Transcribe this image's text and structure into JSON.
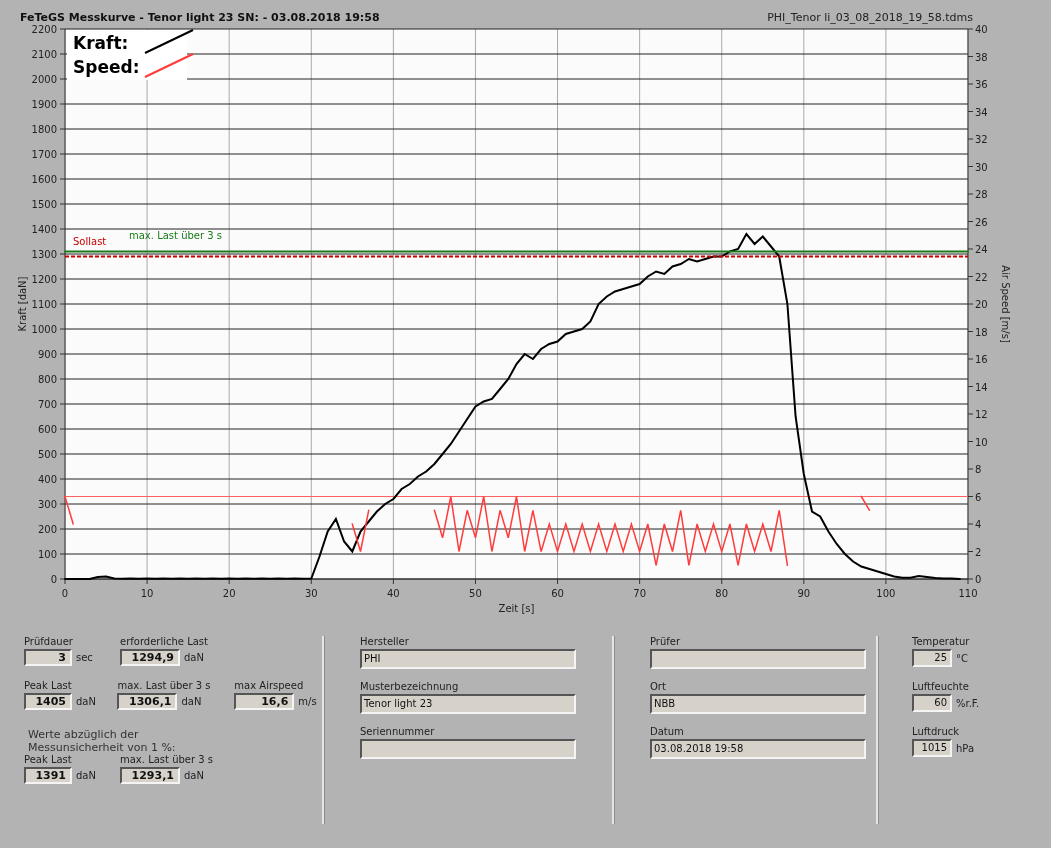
{
  "header": {
    "title": "FeTeGS Messkurve - Tenor light 23  SN:  - 03.08.2018 19:58",
    "file": "PHI_Tenor li_03_08_2018_19_58.tdms"
  },
  "chart": {
    "chart_data": {
      "type": "line",
      "xlabel": "Zeit [s]",
      "ylabel": "Kraft [daN]",
      "y2label": "Air Speed [m/s]",
      "xlim": [
        0,
        110
      ],
      "ylim": [
        0,
        2200
      ],
      "y2lim": [
        0,
        40
      ],
      "xticks": [
        0,
        10,
        20,
        30,
        40,
        50,
        60,
        70,
        80,
        90,
        100,
        110
      ],
      "yticks": [
        0,
        100,
        200,
        300,
        400,
        500,
        600,
        700,
        800,
        900,
        1000,
        1100,
        1200,
        1300,
        1400,
        1500,
        1600,
        1700,
        1800,
        1900,
        2000,
        2100,
        2200
      ],
      "y2ticks": [
        0,
        2,
        4,
        6,
        8,
        10,
        12,
        14,
        16,
        18,
        20,
        22,
        24,
        26,
        28,
        30,
        32,
        34,
        36,
        38,
        40
      ],
      "x": [
        0,
        1,
        2,
        3,
        4,
        5,
        6,
        7,
        8,
        9,
        10,
        11,
        12,
        13,
        14,
        15,
        16,
        17,
        18,
        19,
        20,
        21,
        22,
        23,
        24,
        25,
        26,
        27,
        28,
        29,
        30,
        31,
        32,
        33,
        34,
        35,
        36,
        37,
        38,
        39,
        40,
        41,
        42,
        43,
        44,
        45,
        46,
        47,
        48,
        49,
        50,
        51,
        52,
        53,
        54,
        55,
        56,
        57,
        58,
        59,
        60,
        61,
        62,
        63,
        64,
        65,
        66,
        67,
        68,
        69,
        70,
        71,
        72,
        73,
        74,
        75,
        76,
        77,
        78,
        79,
        80,
        81,
        82,
        83,
        84,
        85,
        86,
        87,
        88,
        89,
        90,
        91,
        92,
        93,
        94,
        95,
        96,
        97,
        98,
        99,
        100,
        101,
        102,
        103,
        104,
        105,
        106,
        107,
        108,
        109,
        110
      ],
      "series": [
        {
          "name": "Kraft:",
          "color": "#000000",
          "values": [
            0,
            0,
            0,
            0,
            8,
            10,
            2,
            1,
            2,
            1,
            2,
            1,
            2,
            1,
            2,
            1,
            2,
            1,
            2,
            1,
            2,
            1,
            2,
            1,
            2,
            1,
            2,
            1,
            2,
            1,
            2,
            90,
            190,
            240,
            150,
            110,
            190,
            230,
            270,
            300,
            320,
            360,
            380,
            410,
            430,
            460,
            500,
            540,
            590,
            640,
            690,
            710,
            720,
            760,
            800,
            860,
            900,
            880,
            920,
            940,
            950,
            980,
            990,
            1000,
            1030,
            1100,
            1130,
            1150,
            1160,
            1170,
            1180,
            1210,
            1230,
            1220,
            1250,
            1260,
            1280,
            1270,
            1280,
            1290,
            1290,
            1310,
            1320,
            1380,
            1340,
            1370,
            1330,
            1290,
            1100,
            650,
            420,
            270,
            250,
            190,
            140,
            100,
            70,
            50,
            40,
            30,
            20,
            10,
            5,
            5,
            12,
            8,
            4,
            2,
            2,
            0,
            null
          ]
        },
        {
          "name": "Speed:",
          "color": "#ff3b3b",
          "axis": "y2",
          "values": [
            6,
            4,
            null,
            null,
            null,
            null,
            null,
            null,
            null,
            null,
            null,
            null,
            null,
            null,
            null,
            null,
            null,
            null,
            null,
            null,
            null,
            null,
            null,
            null,
            null,
            null,
            null,
            null,
            null,
            null,
            null,
            null,
            null,
            null,
            null,
            4,
            2,
            5,
            null,
            null,
            null,
            null,
            null,
            null,
            null,
            5,
            3,
            6,
            2,
            5,
            3,
            6,
            2,
            5,
            3,
            6,
            2,
            5,
            2,
            4,
            2,
            4,
            2,
            4,
            2,
            4,
            2,
            4,
            2,
            4,
            2,
            4,
            1,
            4,
            2,
            5,
            1,
            4,
            2,
            4,
            2,
            4,
            1,
            4,
            2,
            4,
            2,
            5,
            1,
            null,
            null,
            null,
            null,
            null,
            null,
            null,
            null,
            6,
            5,
            null,
            null,
            null,
            null,
            null,
            null,
            null,
            null,
            null,
            null,
            null,
            null
          ]
        },
        {
          "name": "Sollast",
          "color": "#cc0000",
          "line_style": "dashed",
          "values": [
            1290,
            1290,
            1290,
            1290,
            1290,
            1290,
            1290,
            1290,
            1290,
            1290,
            1290,
            1290,
            1290,
            1290,
            1290,
            1290,
            1290,
            1290,
            1290,
            1290,
            1290,
            1290,
            1290,
            1290,
            1290,
            1290,
            1290,
            1290,
            1290,
            1290,
            1290,
            1290,
            1290,
            1290,
            1290,
            1290,
            1290,
            1290,
            1290,
            1290,
            1290,
            1290,
            1290,
            1290,
            1290,
            1290,
            1290,
            1290,
            1290,
            1290,
            1290,
            1290,
            1290,
            1290,
            1290,
            1290,
            1290,
            1290,
            1290,
            1290,
            1290,
            1290,
            1290,
            1290,
            1290,
            1290,
            1290,
            1290,
            1290,
            1290,
            1290,
            1290,
            1290,
            1290,
            1290,
            1290,
            1290,
            1290,
            1290,
            1290,
            1290,
            1290,
            1290,
            1290,
            1290,
            1290,
            1290,
            1290,
            1290,
            1290,
            1290,
            1290,
            1290,
            1290,
            1290,
            1290,
            1290,
            1290,
            1290,
            1290,
            1290,
            1290,
            1290,
            1290,
            1290,
            1290,
            1290,
            1290,
            1290,
            1290,
            1290
          ]
        },
        {
          "name": "max. Last über  3 s",
          "color": "#1a7a1a",
          "values": [
            1310,
            1310,
            1310,
            1310,
            1310,
            1310,
            1310,
            1310,
            1310,
            1310,
            1310,
            1310,
            1310,
            1310,
            1310,
            1310,
            1310,
            1310,
            1310,
            1310,
            1310,
            1310,
            1310,
            1310,
            1310,
            1310,
            1310,
            1310,
            1310,
            1310,
            1310,
            1310,
            1310,
            1310,
            1310,
            1310,
            1310,
            1310,
            1310,
            1310,
            1310,
            1310,
            1310,
            1310,
            1310,
            1310,
            1310,
            1310,
            1310,
            1310,
            1310,
            1310,
            1310,
            1310,
            1310,
            1310,
            1310,
            1310,
            1310,
            1310,
            1310,
            1310,
            1310,
            1310,
            1310,
            1310,
            1310,
            1310,
            1310,
            1310,
            1310,
            1310,
            1310,
            1310,
            1310,
            1310,
            1310,
            1310,
            1310,
            1310,
            1310,
            1310,
            1310,
            1310,
            1310,
            1310,
            1310,
            1310,
            1310,
            1310,
            1310,
            1310,
            1310,
            1310,
            1310,
            1310,
            1310,
            1310,
            1310,
            1310,
            1310,
            1310,
            1310,
            1310,
            1310,
            1310,
            1310,
            1310,
            1310,
            1310,
            1310
          ]
        }
      ],
      "grid": true,
      "legend": "upper left",
      "ref_lines": [
        {
          "value": 6,
          "axis": "y2",
          "color": "#ff6060"
        }
      ]
    }
  },
  "test_values": {
    "rows": [
      [
        {
          "label": "Prüfdauer",
          "value": "3",
          "unit": "sec"
        },
        {
          "label": "erforderliche Last",
          "value": "1294,9",
          "unit": "daN"
        }
      ],
      [
        {
          "label": "Peak Last",
          "value": "1405",
          "unit": "daN"
        },
        {
          "label": "max. Last über  3 s",
          "value": "1306,1",
          "unit": "daN"
        },
        {
          "label": "max Airspeed",
          "value": "16,6",
          "unit": "m/s"
        }
      ]
    ],
    "note": [
      "Werte abzüglich der",
      "Messunsicherheit von 1  %:"
    ],
    "corrected": [
      {
        "label": "Peak Last",
        "value": "1391",
        "unit": "daN"
      },
      {
        "label": "max. Last über  3 s",
        "value": "1293,1",
        "unit": "daN"
      }
    ]
  },
  "info_left": [
    {
      "label": "Hersteller",
      "value": "PHI"
    },
    {
      "label": "Musterbezeichnung",
      "value": "Tenor light 23"
    },
    {
      "label": "Seriennummer"
    }
  ],
  "info_right": [
    {
      "label": "Prüfer"
    },
    {
      "label": "Ort",
      "value": "NBB"
    },
    {
      "label": "Datum",
      "value": "03.08.2018 19:58"
    }
  ],
  "environment": [
    {
      "label": "Temperatur",
      "value": "25",
      "unit": "°C"
    },
    {
      "label": "Luftfeuchte",
      "value": "60",
      "unit": "%r.F."
    },
    {
      "label": "Luftdruck",
      "value": "1015",
      "unit": "hPa"
    }
  ]
}
